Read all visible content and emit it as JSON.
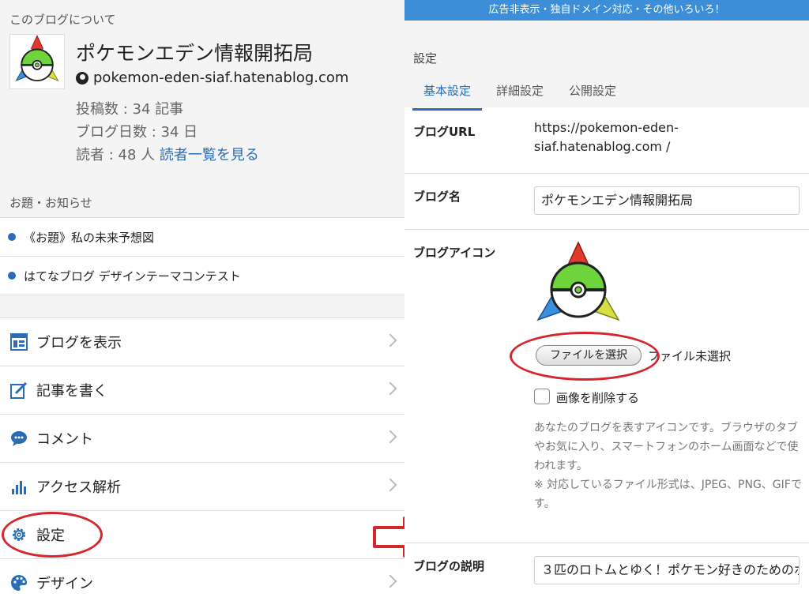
{
  "left": {
    "about_label": "このブログについて",
    "blog_title": "ポケモンエデン情報開拓局",
    "blog_domain": "pokemon-eden-siaf.hatenablog.com",
    "stats": {
      "posts": "投稿数 : 34 記事",
      "days": "ブログ日数 : 34 日",
      "readers": "読者 : 48 人",
      "readers_link": "読者一覧を見る"
    },
    "notice_label": "お題・お知らせ",
    "notices": [
      "《お題》私の未来予想図",
      "はてなブログ デザインテーマコンテスト"
    ],
    "menu": [
      {
        "label": "ブログを表示",
        "icon": "layout-icon"
      },
      {
        "label": "記事を書く",
        "icon": "edit-icon"
      },
      {
        "label": "コメント",
        "icon": "comment-icon"
      },
      {
        "label": "アクセス解析",
        "icon": "analytics-icon"
      },
      {
        "label": "設定",
        "icon": "gear-icon"
      },
      {
        "label": "デザイン",
        "icon": "palette-icon"
      }
    ]
  },
  "right": {
    "banner": "広告非表示・独自ドメイン対応・その他いろいろ！",
    "settings_label": "設定",
    "tabs": [
      "基本設定",
      "詳細設定",
      "公開設定"
    ],
    "active_tab": "基本設定",
    "blog_url_label": "ブログURL",
    "blog_url": "https://pokemon-eden-siaf.hatenablog.com /",
    "blog_name_label": "ブログ名",
    "blog_name": "ポケモンエデン情報開拓局",
    "blog_icon_label": "ブログアイコン",
    "file_button": "ファイルを選択",
    "file_status": "ファイル未選択",
    "delete_image": "画像を削除する",
    "help_text": "あなたのブログを表すアイコンです。ブラウザのタブやお気に入り、スマートフォンのホーム画面などで使われます。",
    "help_formats": "※ 対応しているファイル形式は、JPEG、PNG、GIFです。",
    "blog_desc_label": "ブログの説明",
    "blog_desc": "３匹のロトムとゆく！ポケモン好きのためのポ"
  },
  "colors": {
    "accent": "#2a6db5",
    "banner": "#3d8ed8",
    "highlight": "#d4262c"
  }
}
